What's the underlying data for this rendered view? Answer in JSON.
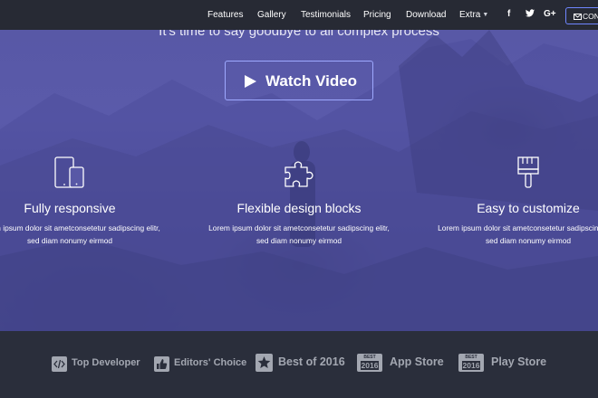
{
  "nav": {
    "links": [
      "Features",
      "Gallery",
      "Testimonials",
      "Pricing",
      "Download",
      "Extra"
    ],
    "extra_caret_icon": "caret-down-icon",
    "social_icons": [
      "facebook-icon",
      "twitter-icon",
      "google-plus-icon"
    ],
    "social_glyphs": [
      "f",
      "🐦",
      "G+"
    ],
    "contact_label": "CONTACT",
    "contact_icon": "envelope-icon"
  },
  "hero": {
    "tagline": "It's time to say goodbye to all complex process",
    "watch_video_label": "Watch Video",
    "features": [
      {
        "icon": "devices-icon",
        "title": "Fully responsive",
        "line1": "Lorem ipsum dolor sit ametconsetetur sadipscing elitr,",
        "line2": "sed diam nonumy eirmod"
      },
      {
        "icon": "puzzle-icon",
        "title": "Flexible design blocks",
        "line1": "Lorem ipsum dolor sit ametconsetetur sadipscing elitr,",
        "line2": "sed diam nonumy eirmod"
      },
      {
        "icon": "paint-brush-icon",
        "title": "Easy to customize",
        "line1": "Lorem ipsum dolor sit ametconsetetur sadipscing elitr,",
        "line2": "sed diam nonumy eirmod"
      }
    ]
  },
  "awards": [
    {
      "icon": "code-icon",
      "label": "Top Developer"
    },
    {
      "icon": "thumbs-up-icon",
      "label": "Editors' Choice"
    },
    {
      "icon": "star-badge-icon",
      "label": "Best of 2016"
    },
    {
      "icon": "best-2016-badge-icon",
      "badge_top": "BEST",
      "badge_year": "2016",
      "label": "App Store"
    },
    {
      "icon": "best-2016-badge-icon",
      "badge_top": "BEST",
      "badge_year": "2016",
      "label": "Play Store"
    }
  ],
  "colors": {
    "navbar": "#272a34",
    "hero_overlay": "#5858a6",
    "footer_band": "#2a2e3b",
    "accent_border": "#9ea9ff",
    "award_text": "#a3a7b1"
  }
}
